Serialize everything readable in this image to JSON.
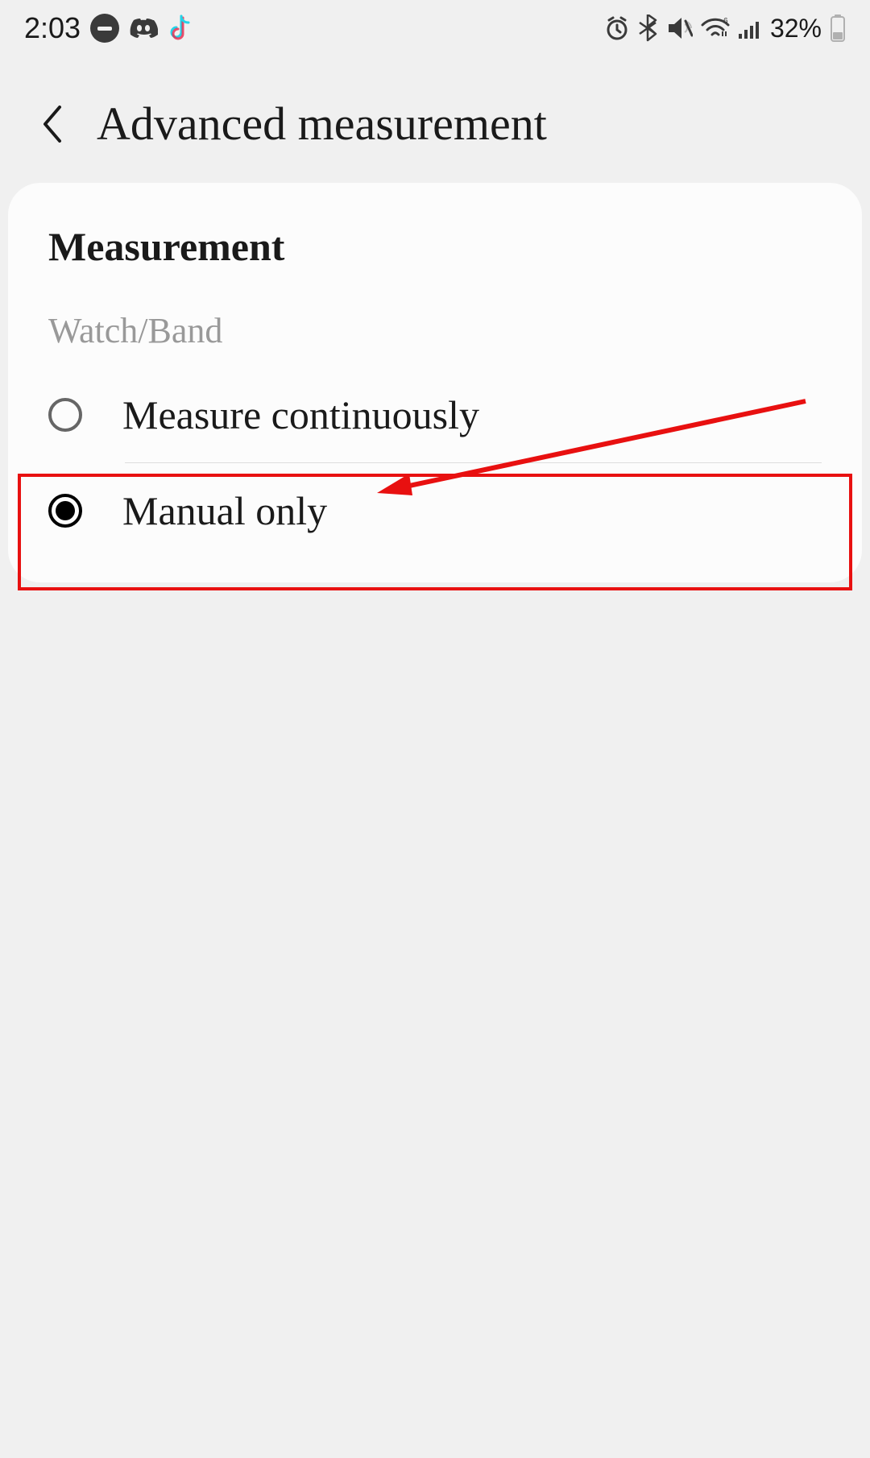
{
  "status": {
    "time": "2:03",
    "battery_percent": "32%"
  },
  "header": {
    "title": "Advanced measurement"
  },
  "card": {
    "title": "Measurement",
    "section_label": "Watch/Band",
    "options": [
      {
        "label": "Measure continuously",
        "selected": false
      },
      {
        "label": "Manual only",
        "selected": true
      }
    ]
  }
}
